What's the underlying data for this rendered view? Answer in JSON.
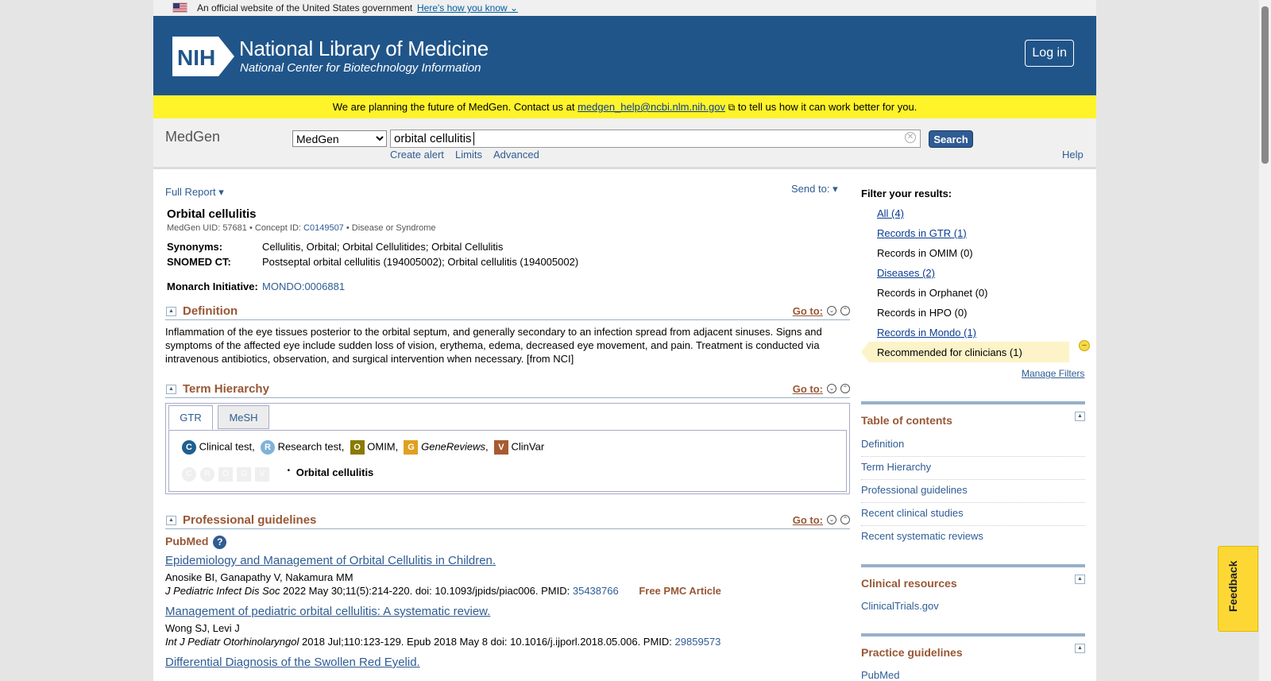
{
  "gov": {
    "text": "An official website of the United States government",
    "link": "Here's how you know"
  },
  "header": {
    "title": "National Library of Medicine",
    "subtitle": "National Center for Biotechnology Information",
    "login": "Log in"
  },
  "banner": {
    "pre": "We are planning the future of MedGen. Contact us at",
    "email": "medgen_help@ncbi.nlm.nih.gov",
    "post": "to tell us how it can work better for you."
  },
  "search": {
    "db_label": "MedGen",
    "db_selected": "MedGen",
    "term": "orbital cellulitis",
    "button": "Search",
    "create_alert": "Create alert",
    "limits": "Limits",
    "advanced": "Advanced",
    "help": "Help"
  },
  "toolbar": {
    "format": "Full Report",
    "send_to": "Send to:"
  },
  "record": {
    "title": "Orbital cellulitis",
    "uid_label": "MedGen UID:",
    "uid": "57681",
    "cid_label": "Concept ID:",
    "cid": "C0149507",
    "type": "Disease or Syndrome",
    "syn_label": "Synonyms:",
    "synonyms": "Cellulitis, Orbital; Orbital Cellulitides; Orbital Cellulitis",
    "snomed_label": "SNOMED CT:",
    "snomed": "Postseptal orbital cellulitis (194005002); Orbital cellulitis (194005002)",
    "monarch_label": "Monarch Initiative:",
    "monarch": "MONDO:0006881"
  },
  "definition": {
    "heading": "Definition",
    "goto": "Go to:",
    "text": "Inflammation of the eye tissues posterior to the orbital septum, and generally secondary to an infection spread from adjacent sinuses. Signs and symptoms of the affected eye include sudden loss of vision, erythema, edema, decreased eye movement, and pain. Treatment is conducted via intravenous antibiotics, observation, and surgical intervention when necessary. [from NCI]"
  },
  "hierarchy": {
    "heading": "Term Hierarchy",
    "goto": "Go to:",
    "tabs": [
      "GTR",
      "MeSH"
    ],
    "legend": [
      {
        "letter": "C",
        "label": "Clinical test,",
        "color": "#1f5f8f"
      },
      {
        "letter": "R",
        "label": "Research test,",
        "color": "#7fb2d9"
      },
      {
        "letter": "O",
        "label": "OMIM,",
        "color": "#8a7a00"
      },
      {
        "letter": "G",
        "label": "GeneReviews",
        "color": "#e0a020"
      },
      {
        "letter": "V",
        "label": "ClinVar",
        "color": "#a85a30"
      }
    ],
    "ghosts": [
      "C",
      "R",
      "O",
      "G",
      "V"
    ],
    "node": "Orbital cellulitis"
  },
  "guidelines": {
    "heading": "Professional guidelines",
    "goto": "Go to:",
    "source": "PubMed",
    "articles": [
      {
        "title": "Epidemiology and Management of Orbital Cellulitis in Children.",
        "authors": "Anosike BI, Ganapathy V, Nakamura MM",
        "journal": "J Pediatric Infect Dis Soc",
        "cite": "2022 May 30;11(5):214-220. doi: 10.1093/jpids/piac006. PMID:",
        "pmid": "35438766",
        "free": "Free PMC Article"
      },
      {
        "title": "Management of pediatric orbital cellulitis: A systematic review.",
        "authors": "Wong SJ, Levi J",
        "journal": "Int J Pediatr Otorhinolaryngol",
        "cite": "2018 Jul;110:123-129. Epub 2018 May 8 doi: 10.1016/j.ijporl.2018.05.006. PMID:",
        "pmid": "29859573",
        "free": ""
      },
      {
        "title": "Differential Diagnosis of the Swollen Red Eyelid.",
        "authors": "",
        "journal": "",
        "cite": "",
        "pmid": "",
        "free": ""
      }
    ]
  },
  "filters": {
    "heading": "Filter your results:",
    "items": [
      {
        "label": "All (4)",
        "link": true
      },
      {
        "label": "Records in GTR (1)",
        "link": true
      },
      {
        "label": "Records in OMIM (0)",
        "link": false
      },
      {
        "label": "Diseases (2)",
        "link": true
      },
      {
        "label": "Records in Orphanet (0)",
        "link": false
      },
      {
        "label": "Records in HPO (0)",
        "link": false
      },
      {
        "label": "Records in Mondo (1)",
        "link": true
      },
      {
        "label": "Recommended for clinicians (1)",
        "link": false
      }
    ],
    "manage": "Manage Filters"
  },
  "toc": {
    "heading": "Table of contents",
    "items": [
      "Definition",
      "Term Hierarchy",
      "Professional guidelines",
      "Recent clinical studies",
      "Recent systematic reviews"
    ]
  },
  "clinical": {
    "heading": "Clinical resources",
    "items": [
      "ClinicalTrials.gov"
    ]
  },
  "practice": {
    "heading": "Practice guidelines",
    "items": [
      "PubMed"
    ]
  },
  "feedback": "Feedback"
}
